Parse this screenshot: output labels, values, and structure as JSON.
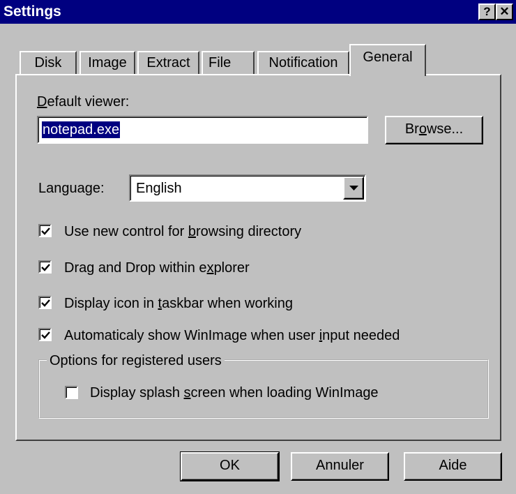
{
  "window": {
    "title": "Settings",
    "help_glyph": "?",
    "close_glyph": "✕"
  },
  "tabs": [
    {
      "label": "Disk",
      "active": false
    },
    {
      "label": "Image",
      "active": false
    },
    {
      "label": "Extract",
      "active": false
    },
    {
      "label": "File",
      "active": false
    },
    {
      "label": "Notification",
      "active": false
    },
    {
      "label": "General",
      "active": true
    }
  ],
  "general": {
    "default_viewer_label_accel": "D",
    "default_viewer_label_rest": "efault viewer:",
    "default_viewer_value": "notepad.exe",
    "browse": {
      "pre": "Br",
      "accel": "o",
      "post": "wse..."
    },
    "language_label": "Language:",
    "language_value": "English",
    "checkboxes": [
      {
        "pre": "Use new control for ",
        "accel": "b",
        "post": "rowsing directory",
        "checked": true
      },
      {
        "pre": "Drag and Drop within e",
        "accel": "x",
        "post": "plorer",
        "checked": true
      },
      {
        "pre": "Display icon in ",
        "accel": "t",
        "post": "askbar when working",
        "checked": true
      },
      {
        "pre": "Automaticaly show WinImage when user ",
        "accel": "i",
        "post": "nput needed",
        "checked": true
      }
    ],
    "registered_group_label": "Options for registered users",
    "splash": {
      "pre": "Display splash ",
      "accel": "s",
      "post": "creen when loading WinImage",
      "checked": false
    }
  },
  "buttons": {
    "ok": "OK",
    "cancel": "Annuler",
    "help": "Aide"
  }
}
